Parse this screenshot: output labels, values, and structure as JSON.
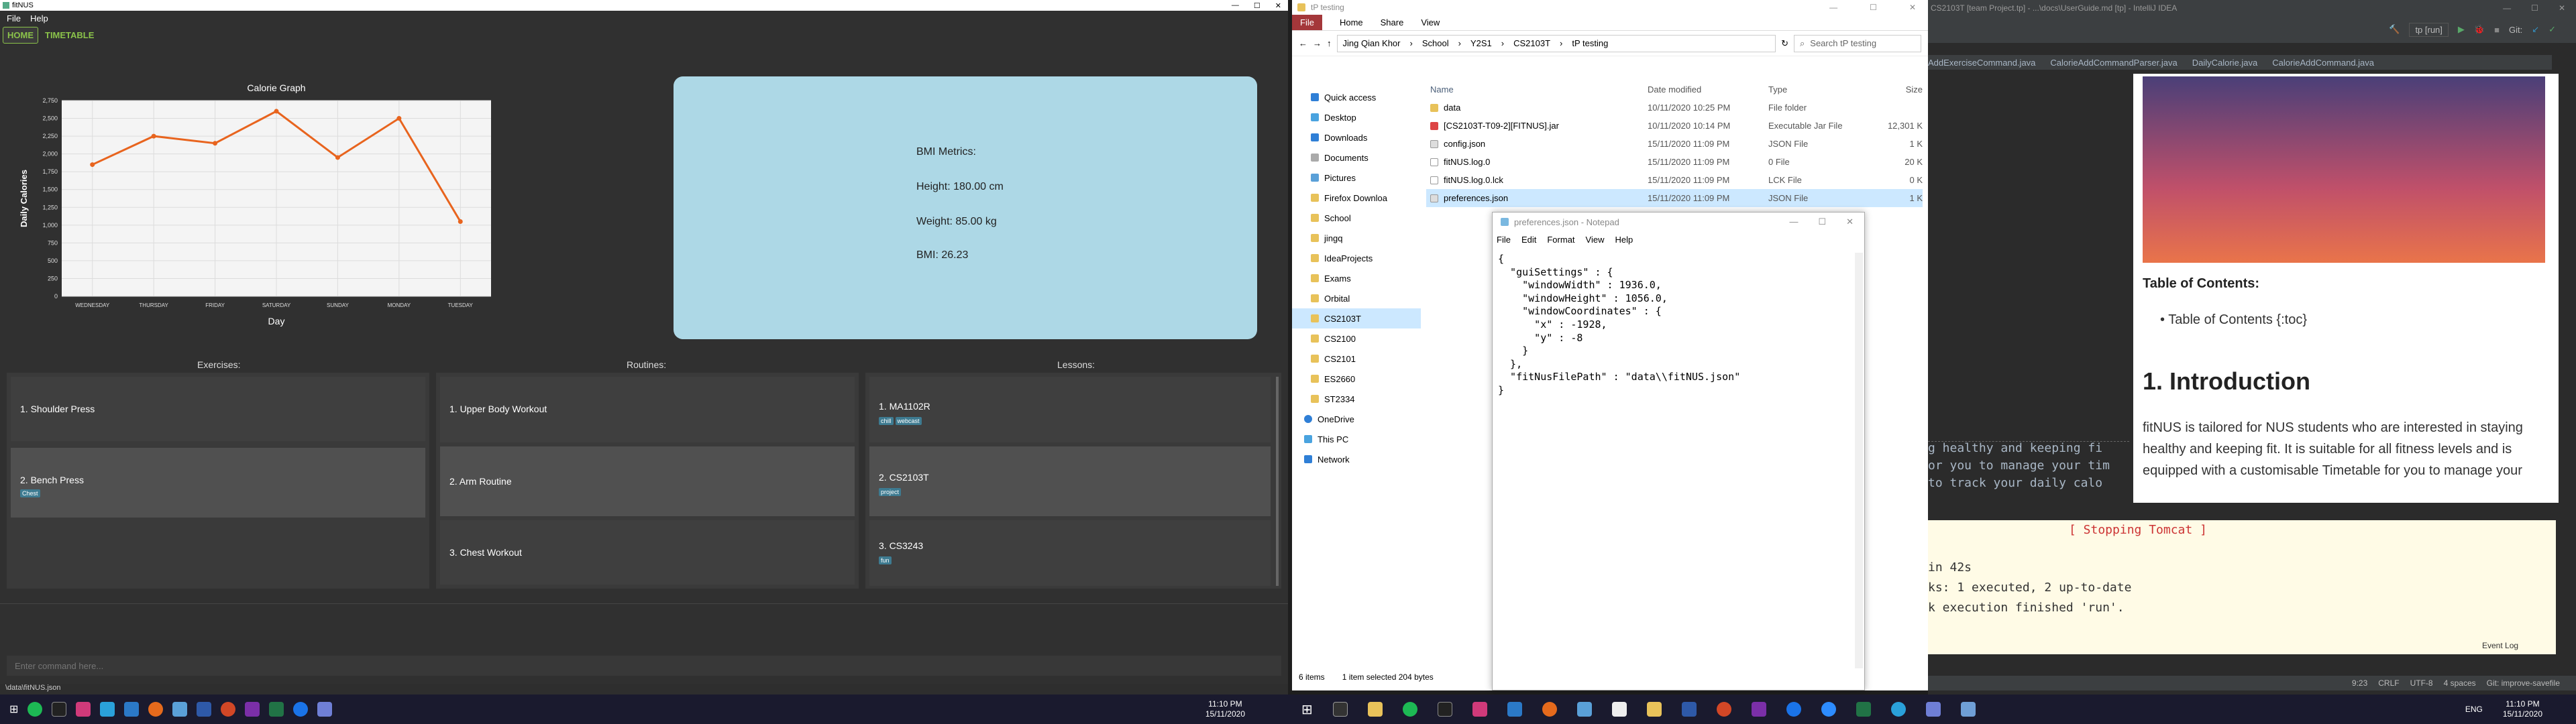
{
  "fitnus": {
    "window_title": "fitNUS",
    "menu": [
      "File",
      "Help"
    ],
    "tabs": [
      "HOME",
      "TIMETABLE"
    ],
    "bmi": {
      "heading": "BMI Metrics:",
      "height": "Height: 180.00 cm",
      "weight": "Weight: 85.00 kg",
      "bmi": "BMI: 26.23"
    },
    "columns": {
      "exercises": "Exercises:",
      "routines": "Routines:",
      "lessons": "Lessons:"
    },
    "exercises": [
      {
        "label": "1.  Shoulder Press",
        "tags": []
      },
      {
        "label": "2.  Bench Press",
        "tags": [
          "Chest"
        ]
      }
    ],
    "routines": [
      {
        "label": "1.  Upper Body Workout"
      },
      {
        "label": "2.  Arm Routine"
      },
      {
        "label": "3.  Chest Workout"
      }
    ],
    "lessons": [
      {
        "label": "1.  MA1102R",
        "tags": [
          "chill",
          "webcast"
        ]
      },
      {
        "label": "2.  CS2103T",
        "tags": [
          "project"
        ]
      },
      {
        "label": "3.  CS3243",
        "tags": [
          "fun"
        ]
      }
    ],
    "command_placeholder": "Enter command here...",
    "status": "\\data\\fitNUS.json"
  },
  "chart_data": {
    "type": "line",
    "title": "Calorie Graph",
    "xlabel": "Day",
    "ylabel": "Daily Calories",
    "categories": [
      "WEDNESDAY",
      "THURSDAY",
      "FRIDAY",
      "SATURDAY",
      "SUNDAY",
      "MONDAY",
      "TUESDAY"
    ],
    "values": [
      1850,
      2250,
      2150,
      2600,
      1950,
      2500,
      1050
    ],
    "ylim": [
      0,
      2750
    ],
    "yticks": [
      0,
      250,
      500,
      750,
      "1,000",
      "1,250",
      "1,500",
      "1,750",
      "2,000",
      "2,250",
      "2,500",
      "2,750"
    ],
    "color": "#e8641e"
  },
  "explorer": {
    "title": "tP testing",
    "ribbon": [
      "File",
      "Home",
      "Share",
      "View"
    ],
    "path": [
      "Jing Qian Khor",
      "School",
      "Y2S1",
      "CS2103T",
      "tP testing"
    ],
    "search": "Search tP testing",
    "nav": [
      "Quick access",
      "Desktop",
      "Downloads",
      "Documents",
      "Pictures",
      "Firefox Downloa",
      "School",
      "jingq",
      "IdeaProjects",
      "Exams",
      "Orbital",
      "CS2103T",
      "CS2100",
      "CS2101",
      "ES2660",
      "ST2334",
      "OneDrive",
      "This PC",
      "Network"
    ],
    "headers": [
      "Name",
      "Date modified",
      "Type",
      "Size"
    ],
    "files": [
      {
        "name": "data",
        "date": "10/11/2020 10:25 PM",
        "type": "File folder",
        "size": ""
      },
      {
        "name": "[CS2103T-T09-2][FITNUS].jar",
        "date": "10/11/2020 10:14 PM",
        "type": "Executable Jar File",
        "size": "12,301 K"
      },
      {
        "name": "config.json",
        "date": "15/11/2020 11:09 PM",
        "type": "JSON File",
        "size": "1 K"
      },
      {
        "name": "fitNUS.log.0",
        "date": "15/11/2020 11:09 PM",
        "type": "0 File",
        "size": "20 K"
      },
      {
        "name": "fitNUS.log.0.lck",
        "date": "15/11/2020 11:09 PM",
        "type": "LCK File",
        "size": "0 K"
      },
      {
        "name": "preferences.json",
        "date": "15/11/2020 11:09 PM",
        "type": "JSON File",
        "size": "1 K"
      }
    ],
    "status": [
      "6 items",
      "1 item selected  204 bytes"
    ]
  },
  "notepad": {
    "title": "preferences.json - Notepad",
    "menu": [
      "File",
      "Edit",
      "Format",
      "View",
      "Help"
    ],
    "content": "{\n  \"guiSettings\" : {\n    \"windowWidth\" : 1936.0,\n    \"windowHeight\" : 1056.0,\n    \"windowCoordinates\" : {\n      \"x\" : -1928,\n      \"y\" : -8\n    }\n  },\n  \"fitNusFilePath\" : \"data\\\\fitNUS.json\"\n}"
  },
  "intellij": {
    "title": "CS2103T [team Project.tp] - ...\\docs\\UserGuide.md [tp] - IntelliJ IDEA",
    "run_config": "tp [run]",
    "tabs": [
      "AddExerciseCommand.java",
      "CalorieAddCommandParser.java",
      "DailyCalorie.java",
      "CalorieAddCommand.java"
    ],
    "md": {
      "toc_heading": "Table of Contents:",
      "toc_item": "Table of Contents {:toc}",
      "h1": "1. Introduction",
      "p": "fitNUS is tailored for NUS students who are interested in staying healthy and keeping fit. It is suitable for all fitness levels and is equipped with a customisable Timetable for you to manage your"
    },
    "code_lines": [
      "g healthy and keeping fi",
      "or you to manage your tim",
      "to track your daily calo"
    ],
    "run_lines": [
      "[ Stopping Tomcat ]",
      " in 42s",
      "ks: 1 executed, 2 up-to-date",
      "k execution finished 'run'."
    ],
    "event_log": "Event Log",
    "status": [
      "9:23",
      "CRLF",
      "UTF-8",
      "4 spaces",
      "Git: improve-savefile"
    ]
  },
  "taskbar": {
    "clock_left": {
      "time": "11:10 PM",
      "date": "15/11/2020"
    },
    "clock_right": {
      "time": "11:10 PM",
      "date": "15/11/2020"
    },
    "lang": "ENG"
  }
}
